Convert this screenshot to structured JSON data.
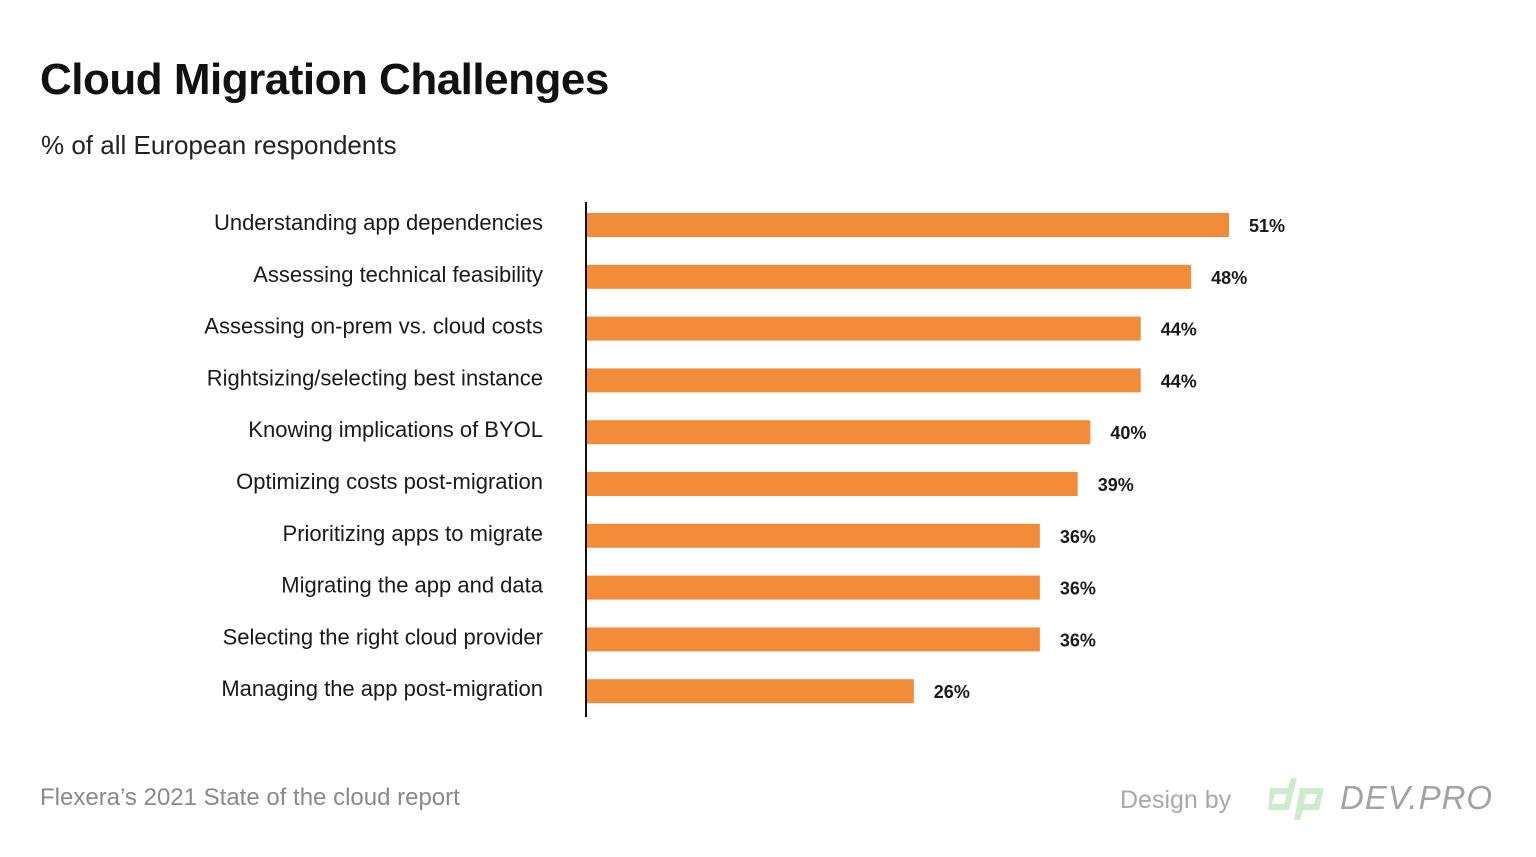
{
  "header": {
    "title": "Cloud Migration Challenges",
    "subtitle": "% of all European respondents"
  },
  "footer": {
    "source": "Flexera’s 2021 State of the cloud report",
    "design_by": "Design by",
    "brand_mark": "dp",
    "brand_name": "DEV.PRO"
  },
  "colors": {
    "bar": "#f28c38",
    "text": "#1a1a1a",
    "axis": "#111111",
    "brand_mark": "#cdeccb",
    "brand_text": "#a3a3a3"
  },
  "chart_data": {
    "type": "bar",
    "orientation": "horizontal",
    "title": "Cloud Migration Challenges",
    "subtitle": "% of all European respondents",
    "xlabel": "",
    "ylabel": "",
    "unit": "%",
    "xlim": [
      0,
      51
    ],
    "grid": false,
    "legend": "none",
    "categories": [
      "Understanding app dependencies",
      "Assessing technical feasibility",
      "Assessing on-prem vs. cloud costs",
      "Rightsizing/selecting best instance",
      "Knowing implications of BYOL",
      "Optimizing costs post-migration",
      "Prioritizing apps to migrate",
      "Migrating the app and data",
      "Selecting the right cloud provider",
      "Managing the app post-migration"
    ],
    "values": [
      51,
      48,
      44,
      44,
      40,
      39,
      36,
      36,
      36,
      26
    ],
    "data_labels": [
      "51%",
      "48%",
      "44%",
      "44%",
      "40%",
      "39%",
      "36%",
      "36%",
      "36%",
      "26%"
    ],
    "source": "Flexera’s 2021 State of the cloud report"
  }
}
